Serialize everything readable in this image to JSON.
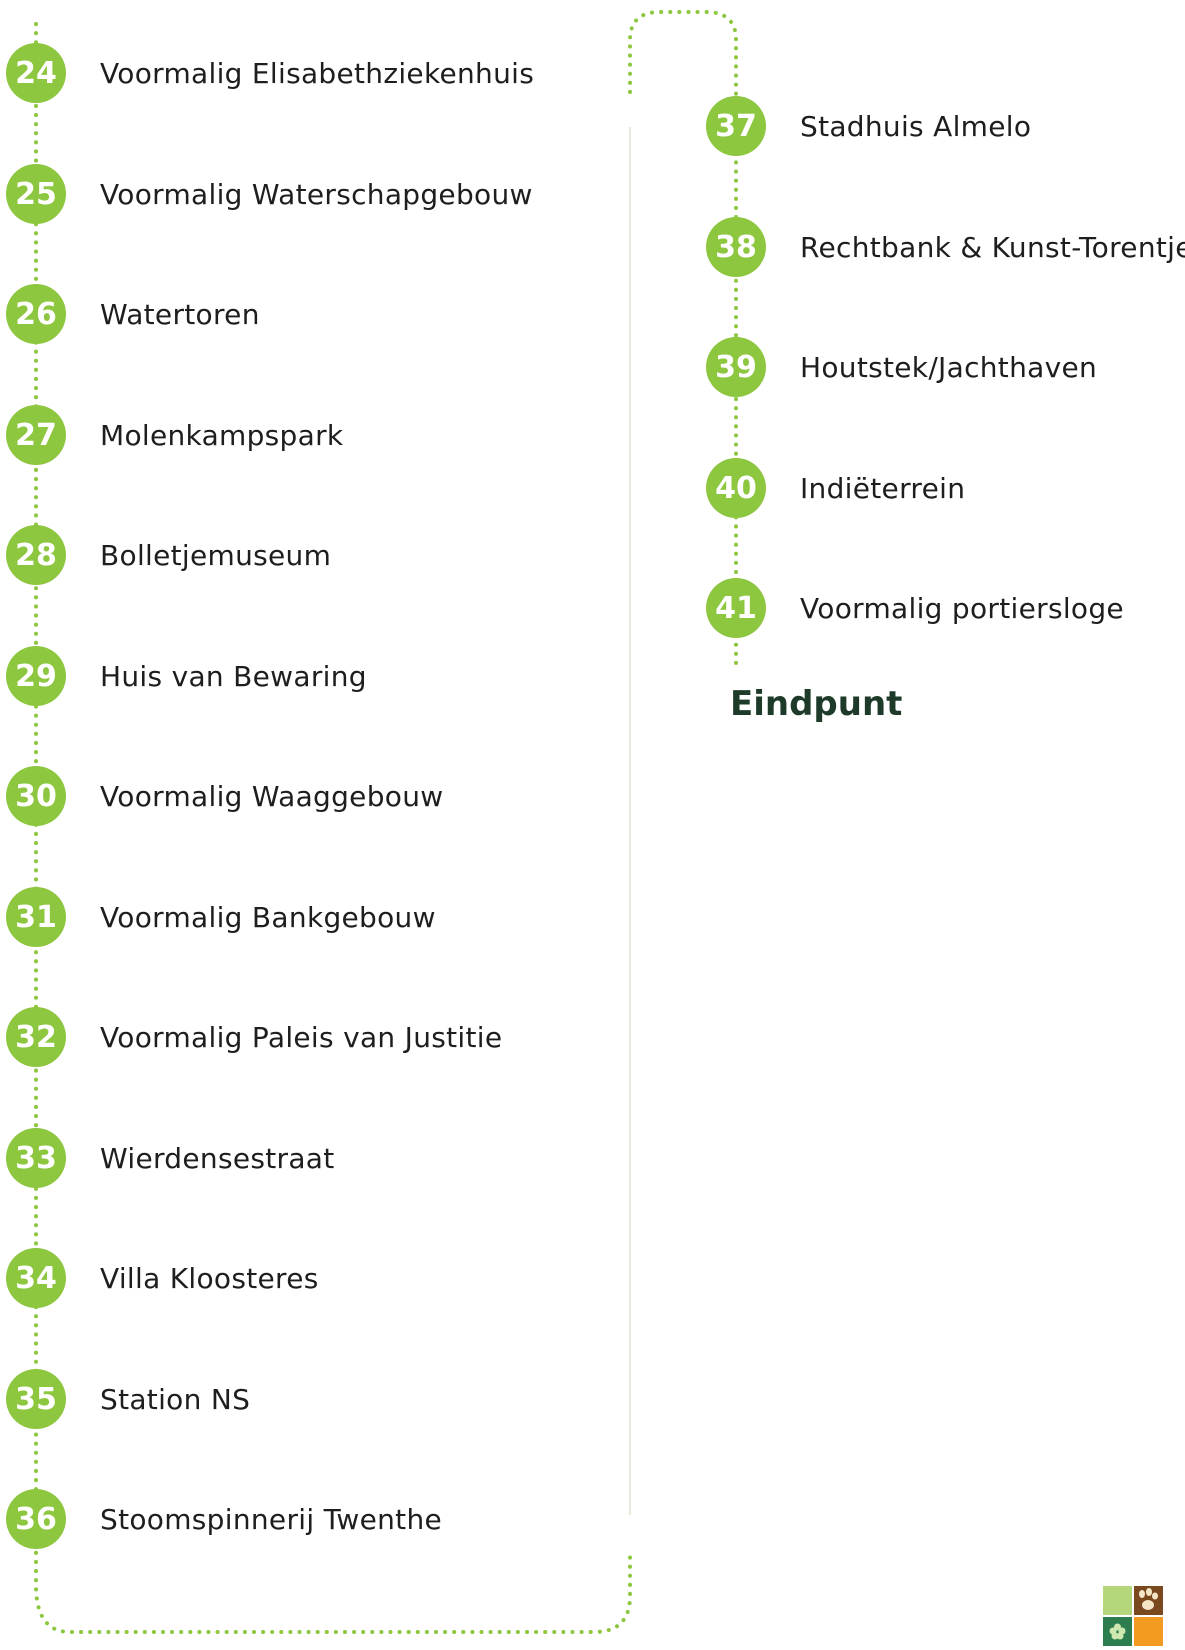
{
  "colors": {
    "accent": "#8dc63f",
    "divider": "#e6ead9",
    "text": "#1e1e1e",
    "endpoint_text": "#1e3b2a",
    "logo_light_green": "#b5d67a",
    "logo_brown": "#7a4a1e",
    "logo_dark_green": "#2e7d4f",
    "logo_orange": "#f29a22"
  },
  "left_stops": [
    {
      "number": "24",
      "label": "Voormalig Elisabethziekenhuis"
    },
    {
      "number": "25",
      "label": "Voormalig Waterschapgebouw"
    },
    {
      "number": "26",
      "label": "Watertoren"
    },
    {
      "number": "27",
      "label": "Molenkampspark"
    },
    {
      "number": "28",
      "label": "Bolletjemuseum"
    },
    {
      "number": "29",
      "label": "Huis van Bewaring"
    },
    {
      "number": "30",
      "label": "Voormalig Waaggebouw"
    },
    {
      "number": "31",
      "label": "Voormalig Bankgebouw"
    },
    {
      "number": "32",
      "label": "Voormalig Paleis van Justitie"
    },
    {
      "number": "33",
      "label": "Wierdensestraat"
    },
    {
      "number": "34",
      "label": "Villa Kloosteres"
    },
    {
      "number": "35",
      "label": "Station NS"
    },
    {
      "number": "36",
      "label": "Stoomspinnerij Twenthe"
    }
  ],
  "right_stops": [
    {
      "number": "37",
      "label": "Stadhuis Almelo"
    },
    {
      "number": "38",
      "label": "Rechtbank & Kunst-Torentje"
    },
    {
      "number": "39",
      "label": "Houtstek/Jachthaven"
    },
    {
      "number": "40",
      "label": "Indiëterrein"
    },
    {
      "number": "41",
      "label": "Voormalig portiersloge"
    }
  ],
  "endpoint_label": "Eindpunt",
  "logo_icons": {
    "top_right": "paw-icon",
    "bottom_left": "flower-icon"
  }
}
